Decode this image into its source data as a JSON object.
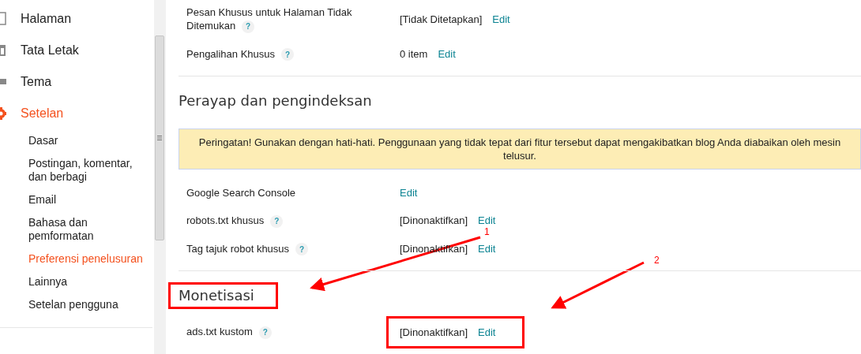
{
  "sidebar": {
    "items": [
      {
        "label": "Halaman",
        "selected": false
      },
      {
        "label": "Tata Letak",
        "selected": false
      },
      {
        "label": "Tema",
        "selected": false
      },
      {
        "label": "Setelan",
        "selected": true,
        "children": [
          {
            "label": "Dasar",
            "selected": false
          },
          {
            "label": "Postingan, komentar, dan berbagi",
            "selected": false
          },
          {
            "label": "Email",
            "selected": false
          },
          {
            "label": "Bahasa dan pemformatan",
            "selected": false
          },
          {
            "label": "Preferensi penelusuran",
            "selected": true
          },
          {
            "label": "Lainnya",
            "selected": false
          },
          {
            "label": "Setelan pengguna",
            "selected": false
          }
        ]
      }
    ]
  },
  "sections": [
    {
      "rows": [
        {
          "label": "Pesan Khusus untuk Halaman Tidak Ditemukan",
          "help": "?",
          "value": "[Tidak Ditetapkan]",
          "link": "Edit",
          "highlighted": false
        },
        {
          "label": "Pengalihan Khusus",
          "help": "?",
          "value": "0 item",
          "link": "Edit",
          "highlighted": false
        }
      ]
    },
    {
      "heading": "Perayap dan pengindeksan",
      "highlighted": false,
      "notice": "Peringatan! Gunakan dengan hati-hati. Penggunaan yang tidak tepat dari fitur tersebut dapat mengakibatkan blog Anda diabaikan oleh mesin telusur.",
      "rows": [
        {
          "label": "Google Search Console",
          "link": "Edit",
          "highlighted": false
        },
        {
          "label": "robots.txt khusus",
          "help": "?",
          "value": "[Dinonaktifkan]",
          "link": "Edit",
          "highlighted": false
        },
        {
          "label": "Tag tajuk robot khusus",
          "help": "?",
          "value": "[Dinonaktifkan]",
          "link": "Edit",
          "highlighted": false
        }
      ]
    },
    {
      "heading": "Monetisasi",
      "highlighted": true,
      "rows": [
        {
          "label": "ads.txt kustom",
          "help": "?",
          "value": "[Dinonaktifkan]",
          "link": "Edit",
          "highlighted": true
        }
      ]
    }
  ],
  "annotations": [
    {
      "label": "1"
    },
    {
      "label": "2"
    }
  ]
}
